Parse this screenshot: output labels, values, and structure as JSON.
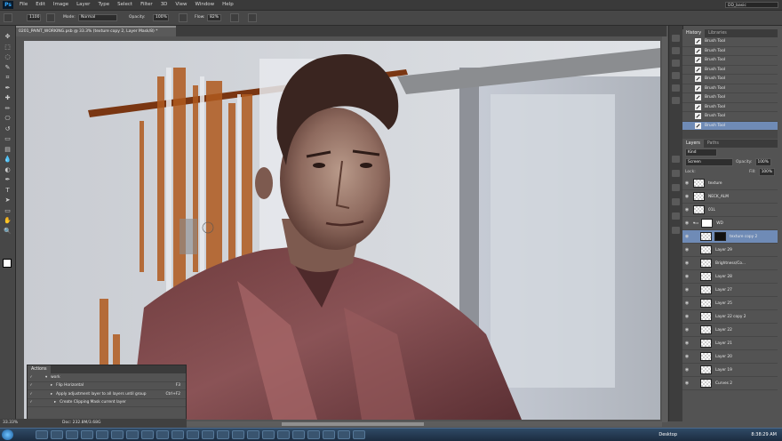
{
  "app": {
    "logo": "Ps"
  },
  "menu": [
    "File",
    "Edit",
    "Image",
    "Layer",
    "Type",
    "Select",
    "Filter",
    "3D",
    "View",
    "Window",
    "Help"
  ],
  "workspace": "DD_basic",
  "options": {
    "size": "1100",
    "mode_label": "Mode:",
    "mode_value": "Normal",
    "opacity_label": "Opacity:",
    "opacity_value": "100%",
    "flow_label": "Flow:",
    "flow_value": "82%"
  },
  "document": {
    "tab_title": "0201_PAINT_WORKING.psb @ 33.3% (texture copy 2, Layer Mask/8) *"
  },
  "status": {
    "zoom": "33.33%",
    "doc": "Doc: 232.8M/3.68G"
  },
  "history": {
    "tabs": [
      "History",
      "Libraries"
    ],
    "items": [
      "Brush Tool",
      "Brush Tool",
      "Brush Tool",
      "Brush Tool",
      "Brush Tool",
      "Brush Tool",
      "Brush Tool",
      "Brush Tool",
      "Brush Tool",
      "Brush Tool"
    ],
    "selected_index": 9
  },
  "layers": {
    "tabs": [
      "Layers",
      "Paths"
    ],
    "kind": "Kind",
    "blend": "Screen",
    "opacity_label": "Opacity:",
    "opacity": "100%",
    "lock_label": "Lock:",
    "fill_label": "Fill:",
    "fill": "100%",
    "rows": [
      {
        "name": "texture",
        "indent": 0
      },
      {
        "name": "NECK_ALM",
        "indent": 0
      },
      {
        "name": "01L",
        "indent": 0
      },
      {
        "name": "WD",
        "indent": 0,
        "group": true
      },
      {
        "name": "texture copy 2",
        "indent": 1,
        "selected": true
      },
      {
        "name": "Layer 29",
        "indent": 1
      },
      {
        "name": "Brightness/Co...",
        "indent": 1
      },
      {
        "name": "Layer 28",
        "indent": 1
      },
      {
        "name": "Layer 27",
        "indent": 1
      },
      {
        "name": "Layer 25",
        "indent": 1
      },
      {
        "name": "Layer 22 copy 2",
        "indent": 1
      },
      {
        "name": "Layer 22",
        "indent": 1
      },
      {
        "name": "Layer 21",
        "indent": 1
      },
      {
        "name": "Layer 20",
        "indent": 1
      },
      {
        "name": "Layer 19",
        "indent": 1
      },
      {
        "name": "Curves 2",
        "indent": 1
      }
    ]
  },
  "actions": {
    "title": "Actions",
    "rows": [
      {
        "label": "work",
        "key": ""
      },
      {
        "label": "Flip Horizontal",
        "key": "F3"
      },
      {
        "label": "Apply adjustment layer to all layers until group",
        "key": "Ctrl+F2"
      },
      {
        "label": "Create Clipping Mask current layer",
        "key": ""
      }
    ]
  },
  "taskbar": {
    "desktop": "Desktop",
    "time": "8:38:29 AM"
  },
  "colors": {
    "panel": "#535353",
    "selection": "#6f8bb6",
    "accent": "#31a8ff"
  }
}
